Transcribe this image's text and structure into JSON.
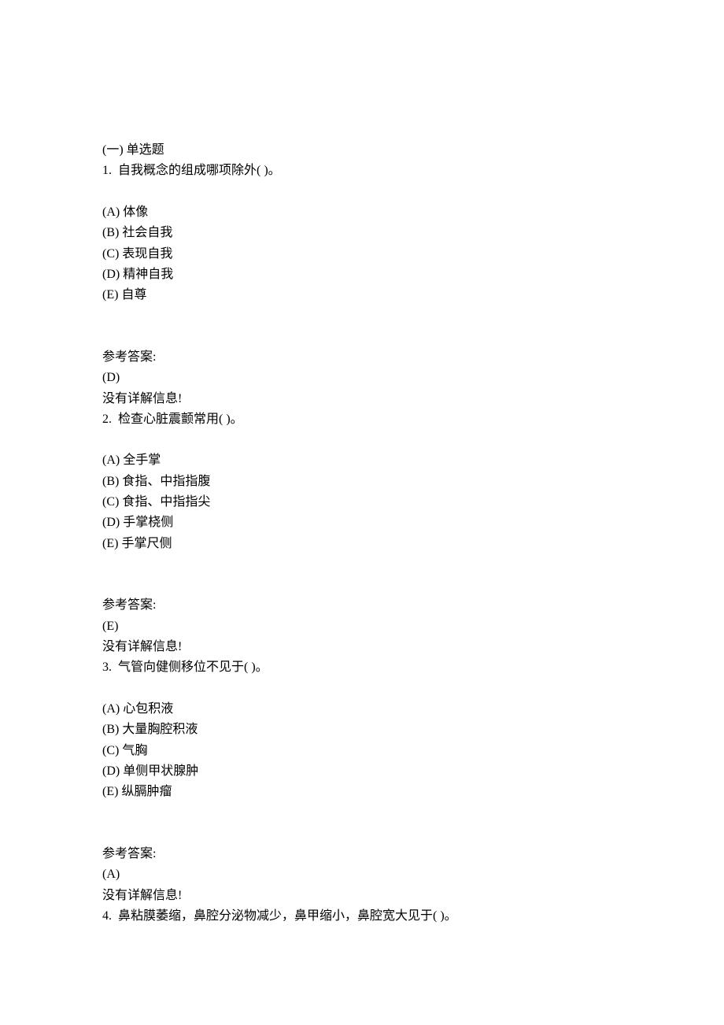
{
  "section": {
    "header": "(一) 单选题"
  },
  "questions": [
    {
      "number": "1.",
      "stem": "自我概念的组成哪项除外( )。",
      "options": [
        {
          "label": "(A)",
          "text": "体像"
        },
        {
          "label": "(B)",
          "text": "社会自我"
        },
        {
          "label": "(C)",
          "text": "表现自我"
        },
        {
          "label": "(D)",
          "text": "精神自我"
        },
        {
          "label": "(E)",
          "text": "自尊"
        }
      ],
      "answer_label": "参考答案:",
      "answer": "(D)",
      "explain": "没有详解信息!"
    },
    {
      "number": "2.",
      "stem": "检查心脏震颤常用( )。",
      "options": [
        {
          "label": "(A)",
          "text": "全手掌"
        },
        {
          "label": "(B)",
          "text": "食指、中指指腹"
        },
        {
          "label": "(C)",
          "text": "食指、中指指尖"
        },
        {
          "label": "(D)",
          "text": "手掌桡侧"
        },
        {
          "label": "(E)",
          "text": "手掌尺侧"
        }
      ],
      "answer_label": "参考答案:",
      "answer": "(E)",
      "explain": "没有详解信息!"
    },
    {
      "number": "3.",
      "stem": "气管向健侧移位不见于( )。",
      "options": [
        {
          "label": "(A)",
          "text": "心包积液"
        },
        {
          "label": "(B)",
          "text": "大量胸腔积液"
        },
        {
          "label": "(C)",
          "text": "气胸"
        },
        {
          "label": "(D)",
          "text": "单侧甲状腺肿"
        },
        {
          "label": "(E)",
          "text": "纵膈肿瘤"
        }
      ],
      "answer_label": "参考答案:",
      "answer": "(A)",
      "explain": "没有详解信息!"
    },
    {
      "number": "4.",
      "stem": "鼻粘膜萎缩，鼻腔分泌物减少，鼻甲缩小，鼻腔宽大见于( )。"
    }
  ]
}
